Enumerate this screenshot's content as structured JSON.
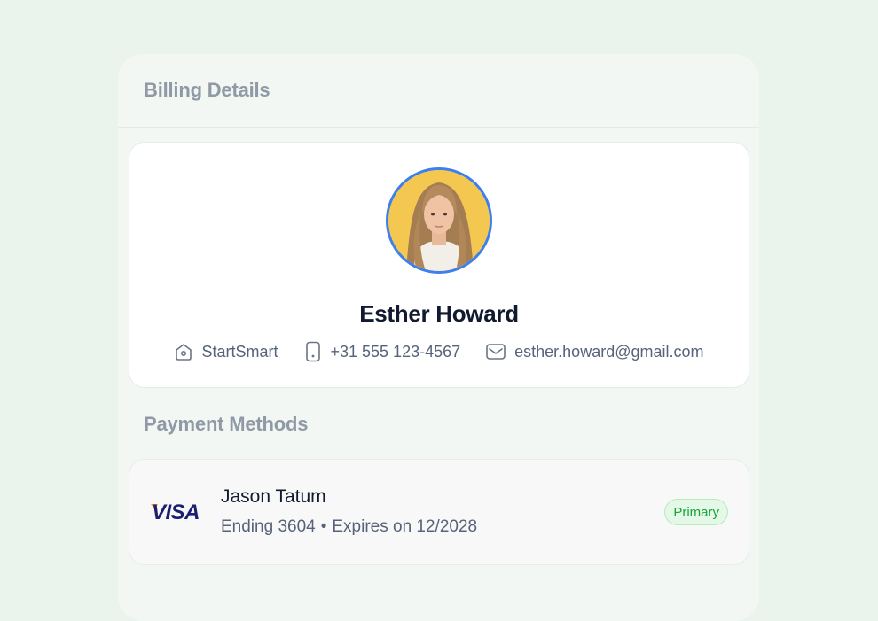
{
  "billing": {
    "title": "Billing Details"
  },
  "profile": {
    "name": "Esther Howard",
    "company": "StartSmart",
    "phone": "+31 555 123-4567",
    "email": "esther.howard@gmail.com"
  },
  "payment": {
    "section_title": "Payment Methods",
    "card": {
      "brand": "VISA",
      "holder": "Jason Tatum",
      "ending": "Ending 3604",
      "separator": "•",
      "expires": "Expires on 12/2028",
      "badge": "Primary"
    }
  },
  "icons": {
    "company": "building-icon",
    "phone": "phone-icon",
    "email": "mail-icon"
  },
  "colors": {
    "background": "#eaf3ec",
    "panel": "#f2f7f3",
    "avatar_ring": "#3c7ff0",
    "badge_text": "#19a33a",
    "badge_bg": "#e3f8e6",
    "visa_blue": "#1a1f71"
  }
}
